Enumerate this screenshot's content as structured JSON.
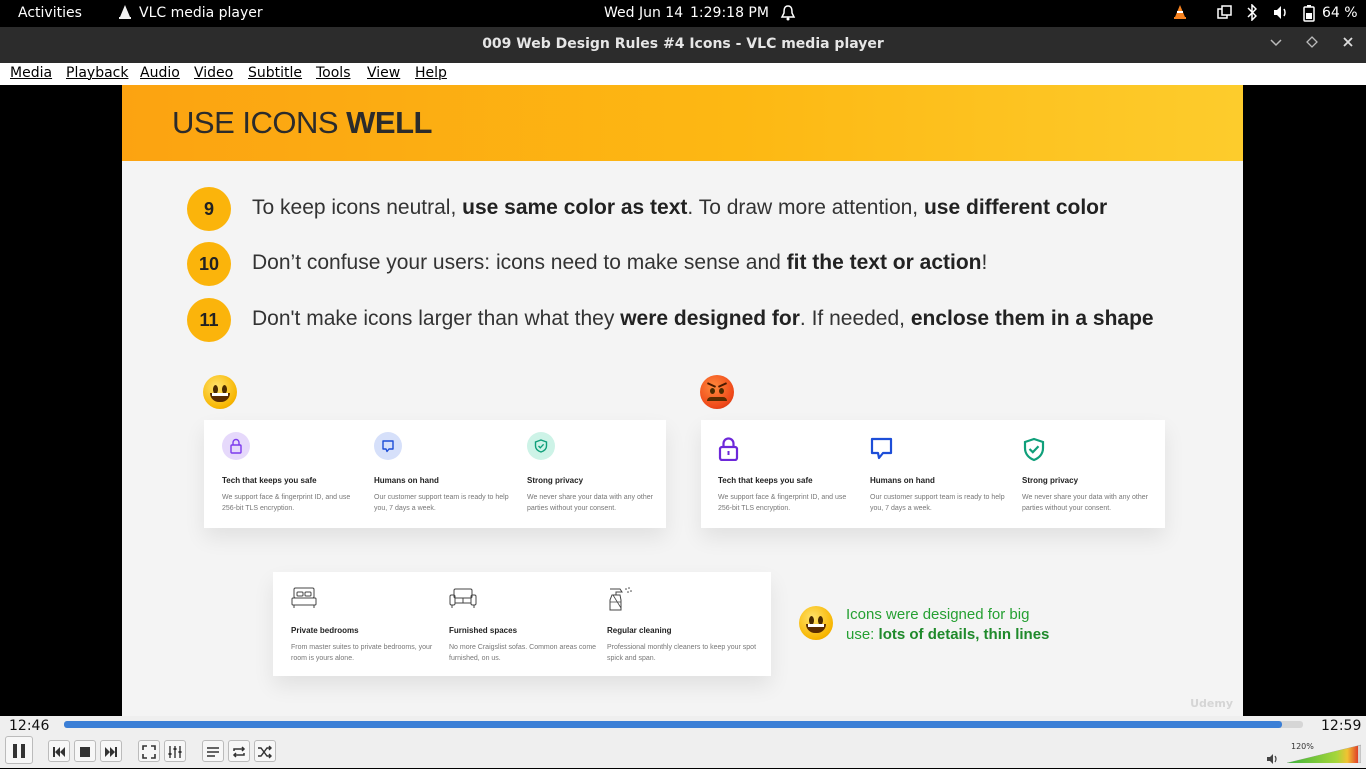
{
  "topbar": {
    "activities": "Activities",
    "app_icon": "vlc-cone-icon",
    "app_name": "VLC media player",
    "date": "Wed Jun 14",
    "time": "1:29:18 PM",
    "battery": "64 %"
  },
  "window": {
    "title": "009 Web Design Rules #4 Icons - VLC media player"
  },
  "menu": [
    "Media",
    "Playback",
    "Audio",
    "Video",
    "Subtitle",
    "Tools",
    "View",
    "Help"
  ],
  "slide": {
    "heading_light": "USE ICONS ",
    "heading_bold": "WELL",
    "rules": [
      {
        "num": "9",
        "parts": [
          {
            "t": "To keep icons neutral, "
          },
          {
            "t": "use same color as text",
            "b": true
          },
          {
            "t": ". To draw more attention, "
          },
          {
            "t": "use different color",
            "b": true
          }
        ]
      },
      {
        "num": "10",
        "parts": [
          {
            "t": "Don’t confuse your users: icons need to make sense and "
          },
          {
            "t": "fit the text or action",
            "b": true
          },
          {
            "t": "!"
          }
        ]
      },
      {
        "num": "11",
        "parts": [
          {
            "t": "Don't make icons larger than what they "
          },
          {
            "t": "were designed for",
            "b": true
          },
          {
            "t": ". If needed, "
          },
          {
            "t": "enclose them in a shape",
            "b": true
          }
        ]
      }
    ],
    "card_features": [
      {
        "title": "Tech that keeps you safe",
        "desc": "We support face & fingerprint ID, and use 256-bit TLS encryption.",
        "icon": "lock-icon",
        "color": "#7c3aed",
        "bg": "#e6d9fb"
      },
      {
        "title": "Humans on hand",
        "desc": "Our customer support team is ready to help you, 7 days a week.",
        "icon": "chat-bubble-icon",
        "color": "#1d4ed8",
        "bg": "#d6e0fa"
      },
      {
        "title": "Strong privacy",
        "desc": "We never share your data with any other parties without your consent.",
        "icon": "shield-check-icon",
        "color": "#0f9f7a",
        "bg": "#cdf3e7"
      }
    ],
    "line_features": [
      {
        "title": "Private bedrooms",
        "desc": "From master suites to private bedrooms, your room is yours alone.",
        "icon": "bed-icon"
      },
      {
        "title": "Furnished spaces",
        "desc": "No more Craigslist sofas. Common areas come furnished, on us.",
        "icon": "sofa-icon"
      },
      {
        "title": "Regular cleaning",
        "desc": "Professional monthly cleaners to keep your spot spick and span.",
        "icon": "spray-bottle-icon"
      }
    ],
    "note_line1": "Icons were designed for big",
    "note_line2_pre": "use: ",
    "note_line2_bold": "lots of details, thin lines",
    "watermark": "Udemy"
  },
  "player": {
    "elapsed": "12:46",
    "total": "12:59",
    "progress": 0.983,
    "volume_label": "120%",
    "volume": 1.2
  }
}
